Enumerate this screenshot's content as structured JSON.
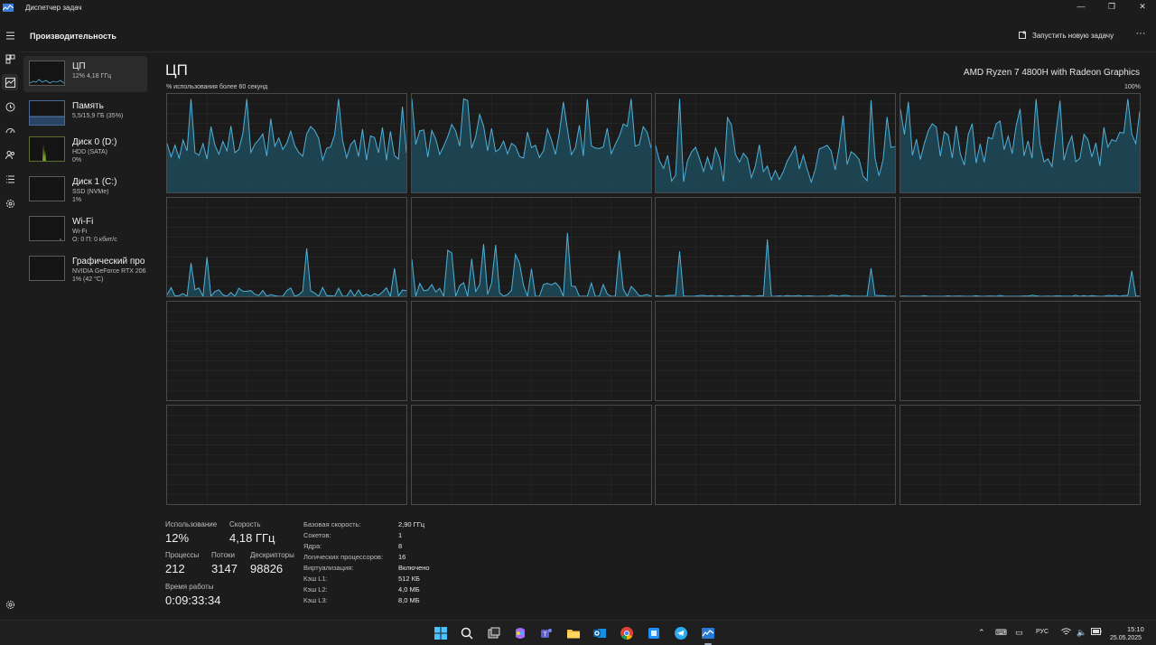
{
  "window": {
    "title": "Диспетчер задач",
    "minimize_glyph": "—",
    "maximize_glyph": "❐",
    "close_glyph": "✕"
  },
  "header": {
    "title": "Производительность",
    "run_task_label": "Запустить новую задачу",
    "more_glyph": "···"
  },
  "sidebar": {
    "items": [
      {
        "name": "ЦП",
        "sub1": "12% 4,18 ГГц",
        "sub2": ""
      },
      {
        "name": "Память",
        "sub1": "5,5/15,9 ГБ (35%)",
        "sub2": ""
      },
      {
        "name": "Диск 0 (D:)",
        "sub1": "HDD (SATA)",
        "sub2": "0%"
      },
      {
        "name": "Диск 1 (C:)",
        "sub1": "SSD (NVMe)",
        "sub2": "1%"
      },
      {
        "name": "Wi-Fi",
        "sub1": "Wi-Fi",
        "sub2": "О: 0 П: 0 кбит/с"
      },
      {
        "name": "Графический про",
        "sub1": "NVIDIA GeForce RTX 206",
        "sub2": "1% (42 °C)"
      }
    ]
  },
  "main": {
    "title": "ЦП",
    "cpu_model": "AMD Ryzen 7 4800H with Radeon Graphics",
    "graph_caption": "% использования более 60 секунд",
    "graph_max": "100%"
  },
  "stats": {
    "usage_label": "Использование",
    "usage_value": "12%",
    "speed_label": "Скорость",
    "speed_value": "4,18 ГГц",
    "processes_label": "Процессы",
    "processes_value": "212",
    "threads_label": "Потоки",
    "threads_value": "3147",
    "handles_label": "Дескрипторы",
    "handles_value": "98826",
    "uptime_label": "Время работы",
    "uptime_value": "0:09:33:34"
  },
  "details": [
    {
      "key": "Базовая скорость:",
      "value": "2,90 ГГц"
    },
    {
      "key": "Сокетов:",
      "value": "1"
    },
    {
      "key": "Ядра:",
      "value": "8"
    },
    {
      "key": "Логических процессоров:",
      "value": "16"
    },
    {
      "key": "Виртуализация:",
      "value": "Включено"
    },
    {
      "key": "Кэш L1:",
      "value": "512 КБ"
    },
    {
      "key": "Кэш L2:",
      "value": "4,0 МБ"
    },
    {
      "key": "Кэш L3:",
      "value": "8,0 МБ"
    }
  ],
  "taskbar": {
    "language": "РУС",
    "time": "15:10",
    "date": "25.05.2025",
    "apps": [
      "start",
      "search",
      "task-view",
      "copilot",
      "teams",
      "file-explorer",
      "outlook",
      "chrome",
      "app-blue",
      "telegram",
      "task-manager"
    ]
  },
  "colors": {
    "graph_line": "#4fb0d8",
    "graph_fill": "#1d4a5a",
    "accent": "#4fb0d8"
  }
}
